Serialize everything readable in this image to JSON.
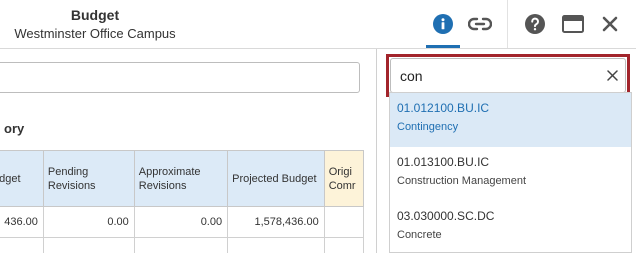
{
  "header": {
    "title": "Budget",
    "subtitle": "Westminster Office Campus",
    "icons": [
      "info-icon",
      "link-icon",
      "help-icon",
      "window-icon",
      "close-icon"
    ],
    "accent_color": "#1f6fb2"
  },
  "left": {
    "filter_value": "",
    "section_heading": "ory",
    "columns": [
      "udget",
      "Pending Revisions",
      "Approximate Revisions",
      "Projected Budget",
      "Origi Comr"
    ],
    "rows": [
      [
        "436.00",
        "0.00",
        "0.00",
        "1,578,436.00",
        ""
      ]
    ]
  },
  "search": {
    "value": "con",
    "highlight_color": "#a2242b",
    "results": [
      {
        "code": "01.012100.BU.IC",
        "name": "Contingency"
      },
      {
        "code": "01.013100.BU.IC",
        "name": "Construction Management"
      },
      {
        "code": "03.030000.SC.DC",
        "name": "Concrete"
      }
    ]
  }
}
